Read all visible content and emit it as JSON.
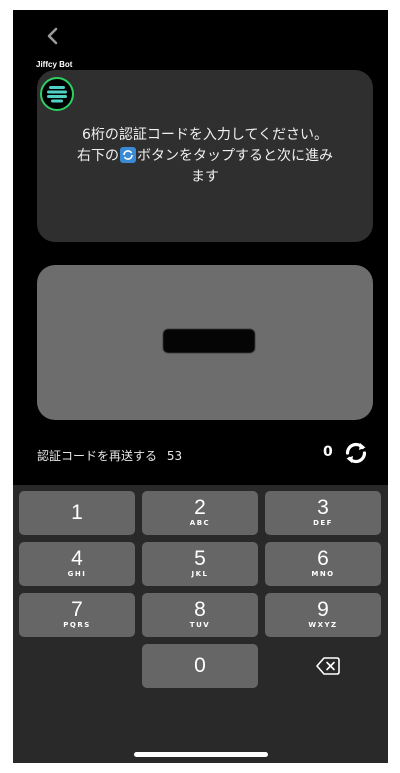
{
  "header": {
    "bot_name": "Jiffcy Bot"
  },
  "message": {
    "line1": "6桁の認証コードを入力してください。",
    "line2_before": "右下の",
    "line2_after": "ボタンをタップすると次に進み",
    "line3": "ます"
  },
  "resend": {
    "label": "認証コードを再送する",
    "seconds": "53"
  },
  "digit_count": "0",
  "keypad": {
    "keys": [
      {
        "num": "1",
        "letters": ""
      },
      {
        "num": "2",
        "letters": "ABC"
      },
      {
        "num": "3",
        "letters": "DEF"
      },
      {
        "num": "4",
        "letters": "GHI"
      },
      {
        "num": "5",
        "letters": "JKL"
      },
      {
        "num": "6",
        "letters": "MNO"
      },
      {
        "num": "7",
        "letters": "PQRS"
      },
      {
        "num": "8",
        "letters": "TUV"
      },
      {
        "num": "9",
        "letters": "WXYZ"
      },
      {
        "num": "0",
        "letters": ""
      }
    ]
  },
  "colors": {
    "background": "#000000",
    "card": "#2f2f2f",
    "code_field": "#6d6d6d",
    "keypad_bg": "#292929",
    "key": "#666666",
    "avatar_ring": "#2fcf63",
    "avatar_bars": "#4fd1c5"
  },
  "icons": {
    "back": "chevron-left-icon",
    "avatar": "bot-avatar-icon",
    "refresh": "refresh-icon",
    "delete": "backspace-icon"
  }
}
